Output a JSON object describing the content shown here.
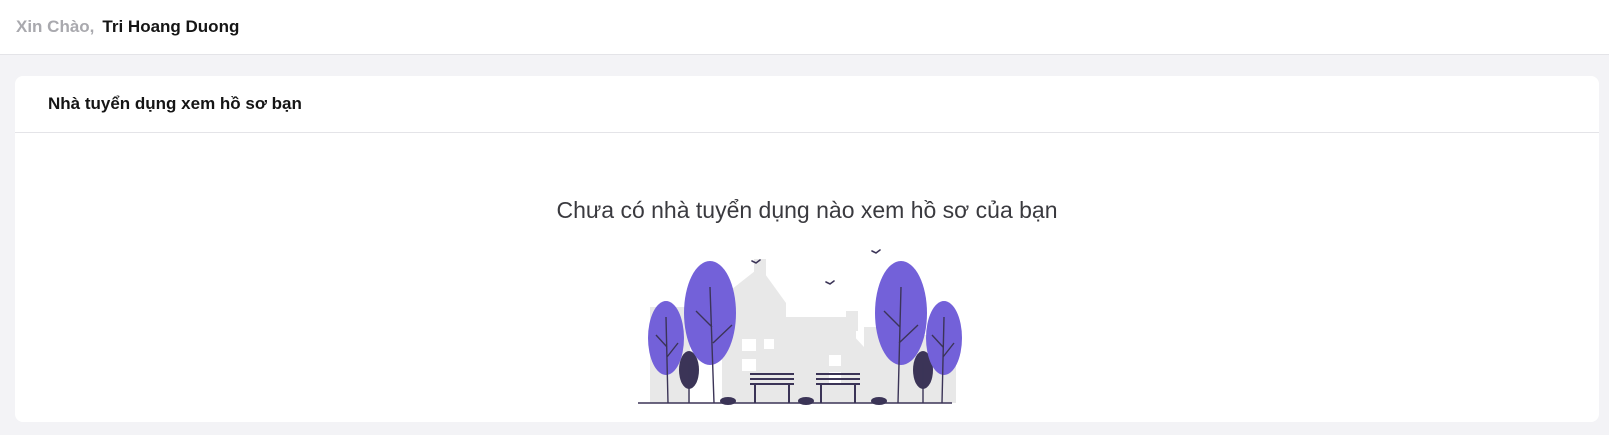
{
  "header": {
    "greeting_label": "Xin Chào,",
    "user_name": "Tri Hoang Duong"
  },
  "card": {
    "title": "Nhà tuyển dụng xem hồ sơ bạn",
    "empty_message": "Chưa có nhà tuyển dụng nào xem hồ sơ của bạn"
  },
  "colors": {
    "tree_purple": "#7361d9",
    "bush_dark": "#3b3457",
    "building_gray": "#e8e8e8"
  },
  "icons": {
    "illustration": "empty-neighborhood-illustration"
  }
}
